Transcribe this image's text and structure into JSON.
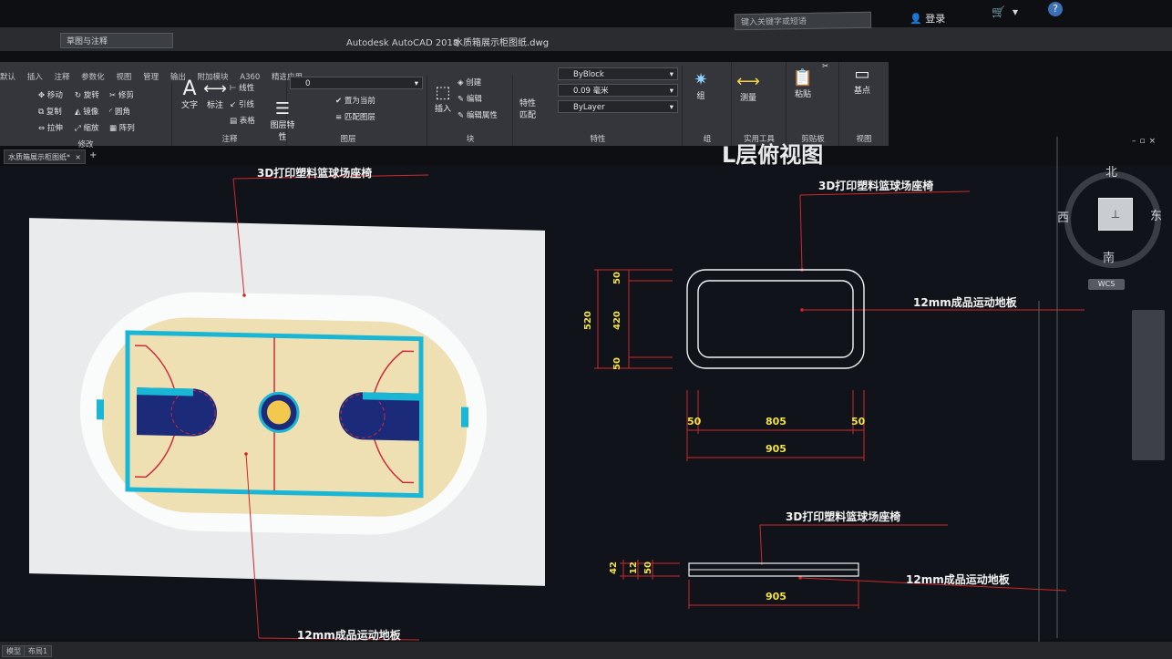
{
  "window": {
    "app_title": "Autodesk AutoCAD 2018",
    "filename": "水质箱展示柜图纸.dwg"
  },
  "quick_access": {
    "workspace": "草图与注释"
  },
  "search": {
    "placeholder": "键入关键字或短语"
  },
  "account": {
    "login": "登录"
  },
  "ribbon_tabs": [
    "默认",
    "插入",
    "注释",
    "参数化",
    "视图",
    "管理",
    "输出",
    "附加模块",
    "A360",
    "精选应用"
  ],
  "ribbon": {
    "modify": {
      "move": "移动",
      "rotate": "旋转",
      "trim": "修剪",
      "copy": "复制",
      "mirror": "镜像",
      "fillet": "圆角",
      "stretch": "拉伸",
      "scale": "缩放",
      "array": "阵列",
      "footer": "修改"
    },
    "annotation": {
      "text": "文字",
      "dimension": "标注",
      "linear": "线性",
      "leader": "引线",
      "table": "表格",
      "footer": "注释"
    },
    "layers": {
      "layer_props": "图层特性",
      "current_layer": "0",
      "set_current": "置为当前",
      "match_layer": "匹配图层",
      "footer": "图层"
    },
    "block": {
      "insert": "插入",
      "create": "创建",
      "edit": "编辑",
      "edit_attr": "编辑属性",
      "footer": "块"
    },
    "properties": {
      "match": "特性匹配",
      "color": "ByBlock",
      "lineweight": "0.09 毫米",
      "linetype": "ByLayer",
      "footer": "特性"
    },
    "groups": {
      "group": "组",
      "footer": "组"
    },
    "utilities": {
      "measure": "测量",
      "footer": "实用工具"
    },
    "clipboard": {
      "paste": "粘贴",
      "footer": "剪贴板"
    },
    "view": {
      "base": "基点",
      "footer": "视图"
    }
  },
  "doc_tab": {
    "name": "水质箱展示柜图纸*"
  },
  "viewcube": {
    "north": "北",
    "south": "南",
    "west": "西",
    "east": "东",
    "wcs": "WCS"
  },
  "status_tabs": [
    "模型",
    "布局1"
  ],
  "drawing": {
    "heading": "L层俯视图",
    "seat_label": "3D打印塑料篮球场座椅",
    "floor_label": "12mm成品运动地板",
    "dims": {
      "side_v": [
        "50",
        "420",
        "50"
      ],
      "total_v": "520",
      "bottom_h": [
        "50",
        "805",
        "50"
      ],
      "total_h": "905",
      "elev_v": [
        "42",
        "12",
        "50"
      ],
      "elev_total": "905"
    }
  },
  "colors": {
    "court_wood": "#efe0b4",
    "court_blue": "#1c2a7a",
    "court_cyan": "#19b6d6",
    "court_red": "#cc2b3b",
    "dim_yellow": "#f2e24a",
    "leader_red": "#d02828"
  }
}
